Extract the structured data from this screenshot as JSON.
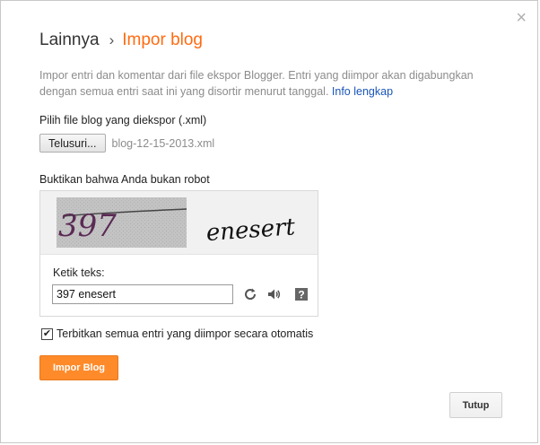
{
  "dialog": {
    "close_glyph": "×",
    "breadcrumb": {
      "parent": "Lainnya",
      "separator": "›",
      "current": "Impor blog"
    },
    "description": {
      "text": "Impor entri dan komentar dari file ekspor Blogger. Entri yang diimpor akan digabungkan dengan semua entri saat ini yang disortir menurut tanggal.",
      "link": "Info lengkap"
    },
    "file": {
      "label": "Pilih file blog yang diekspor (.xml)",
      "browse_label": "Telusuri...",
      "filename": "blog-12-15-2013.xml"
    },
    "captcha": {
      "label": "Buktikan bahwa Anda bukan robot",
      "image_text_left": "397",
      "image_text_right": "enesert",
      "input_label": "Ketik teks:",
      "input_value": "397 enesert",
      "icons": [
        "refresh-icon",
        "audio-icon",
        "help-icon"
      ]
    },
    "publish_checkbox": {
      "checked": true,
      "label": "Terbitkan semua entri yang diimpor secara otomatis"
    },
    "import_button": "Impor Blog",
    "close_button": "Tutup",
    "colors": {
      "accent": "#ff6b11",
      "import_button": "#ff8a2a",
      "link": "#1a55b8"
    }
  }
}
